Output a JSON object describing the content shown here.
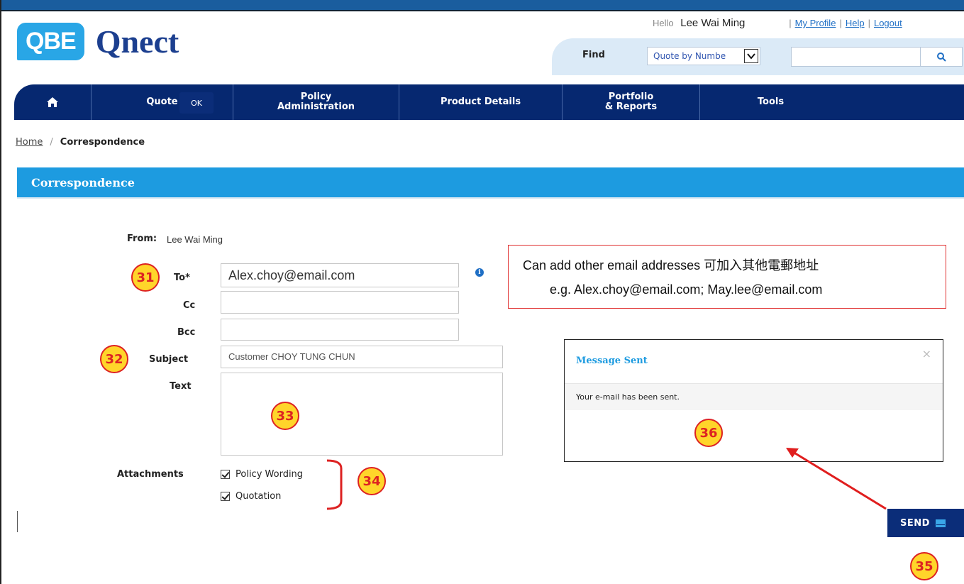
{
  "header": {
    "logo_badge": "QBE",
    "logo_text": "Qnect",
    "hello_label": "Hello",
    "user_name": "Lee Wai Ming",
    "links": [
      "My Profile",
      "Help",
      "Logout"
    ],
    "find_label": "Find",
    "find_select_value": "Quote by Numbe",
    "find_input_value": ""
  },
  "nav": {
    "items": [
      {
        "label": "",
        "icon": "home-icon"
      },
      {
        "label": "Quote"
      },
      {
        "label": "Policy\nAdministration"
      },
      {
        "label": "Product Details"
      },
      {
        "label": "Portfolio\n& Reports"
      },
      {
        "label": "Tools"
      }
    ]
  },
  "breadcrumb": {
    "home": "Home",
    "separator": "/",
    "current": "Correspondence"
  },
  "section": {
    "title": "Correspondence"
  },
  "form": {
    "from_label": "From:",
    "from_value": "Lee Wai Ming",
    "to_label": "To*",
    "to_value": "Alex.choy@email.com",
    "cc_label": "Cc",
    "cc_value": "",
    "bcc_label": "Bcc",
    "bcc_value": "",
    "subject_label": "Subject",
    "subject_value": "Customer CHOY TUNG CHUN",
    "text_label": "Text",
    "text_value": "",
    "attachments_label": "Attachments",
    "attachments": [
      {
        "label": "Policy Wording",
        "checked": true
      },
      {
        "label": "Quotation",
        "checked": true
      }
    ]
  },
  "note": {
    "line1": "Can add other email addresses 可加入其他電郵地址",
    "line2": "e.g. Alex.choy@email.com; May.lee@email.com"
  },
  "modal": {
    "title": "Message Sent",
    "close": "×",
    "message": "Your e-mail has been sent.",
    "ok_label": "OK"
  },
  "send_label": "SEND",
  "badges": {
    "b31": "31",
    "b32": "32",
    "b33": "33",
    "b34": "34",
    "b35": "35",
    "b36": "36"
  },
  "colors": {
    "nav": "#062870",
    "section": "#1d9be0",
    "badge_fill": "#ffd52a",
    "badge_border": "#dd2222",
    "arrow": "#e01e1e"
  }
}
